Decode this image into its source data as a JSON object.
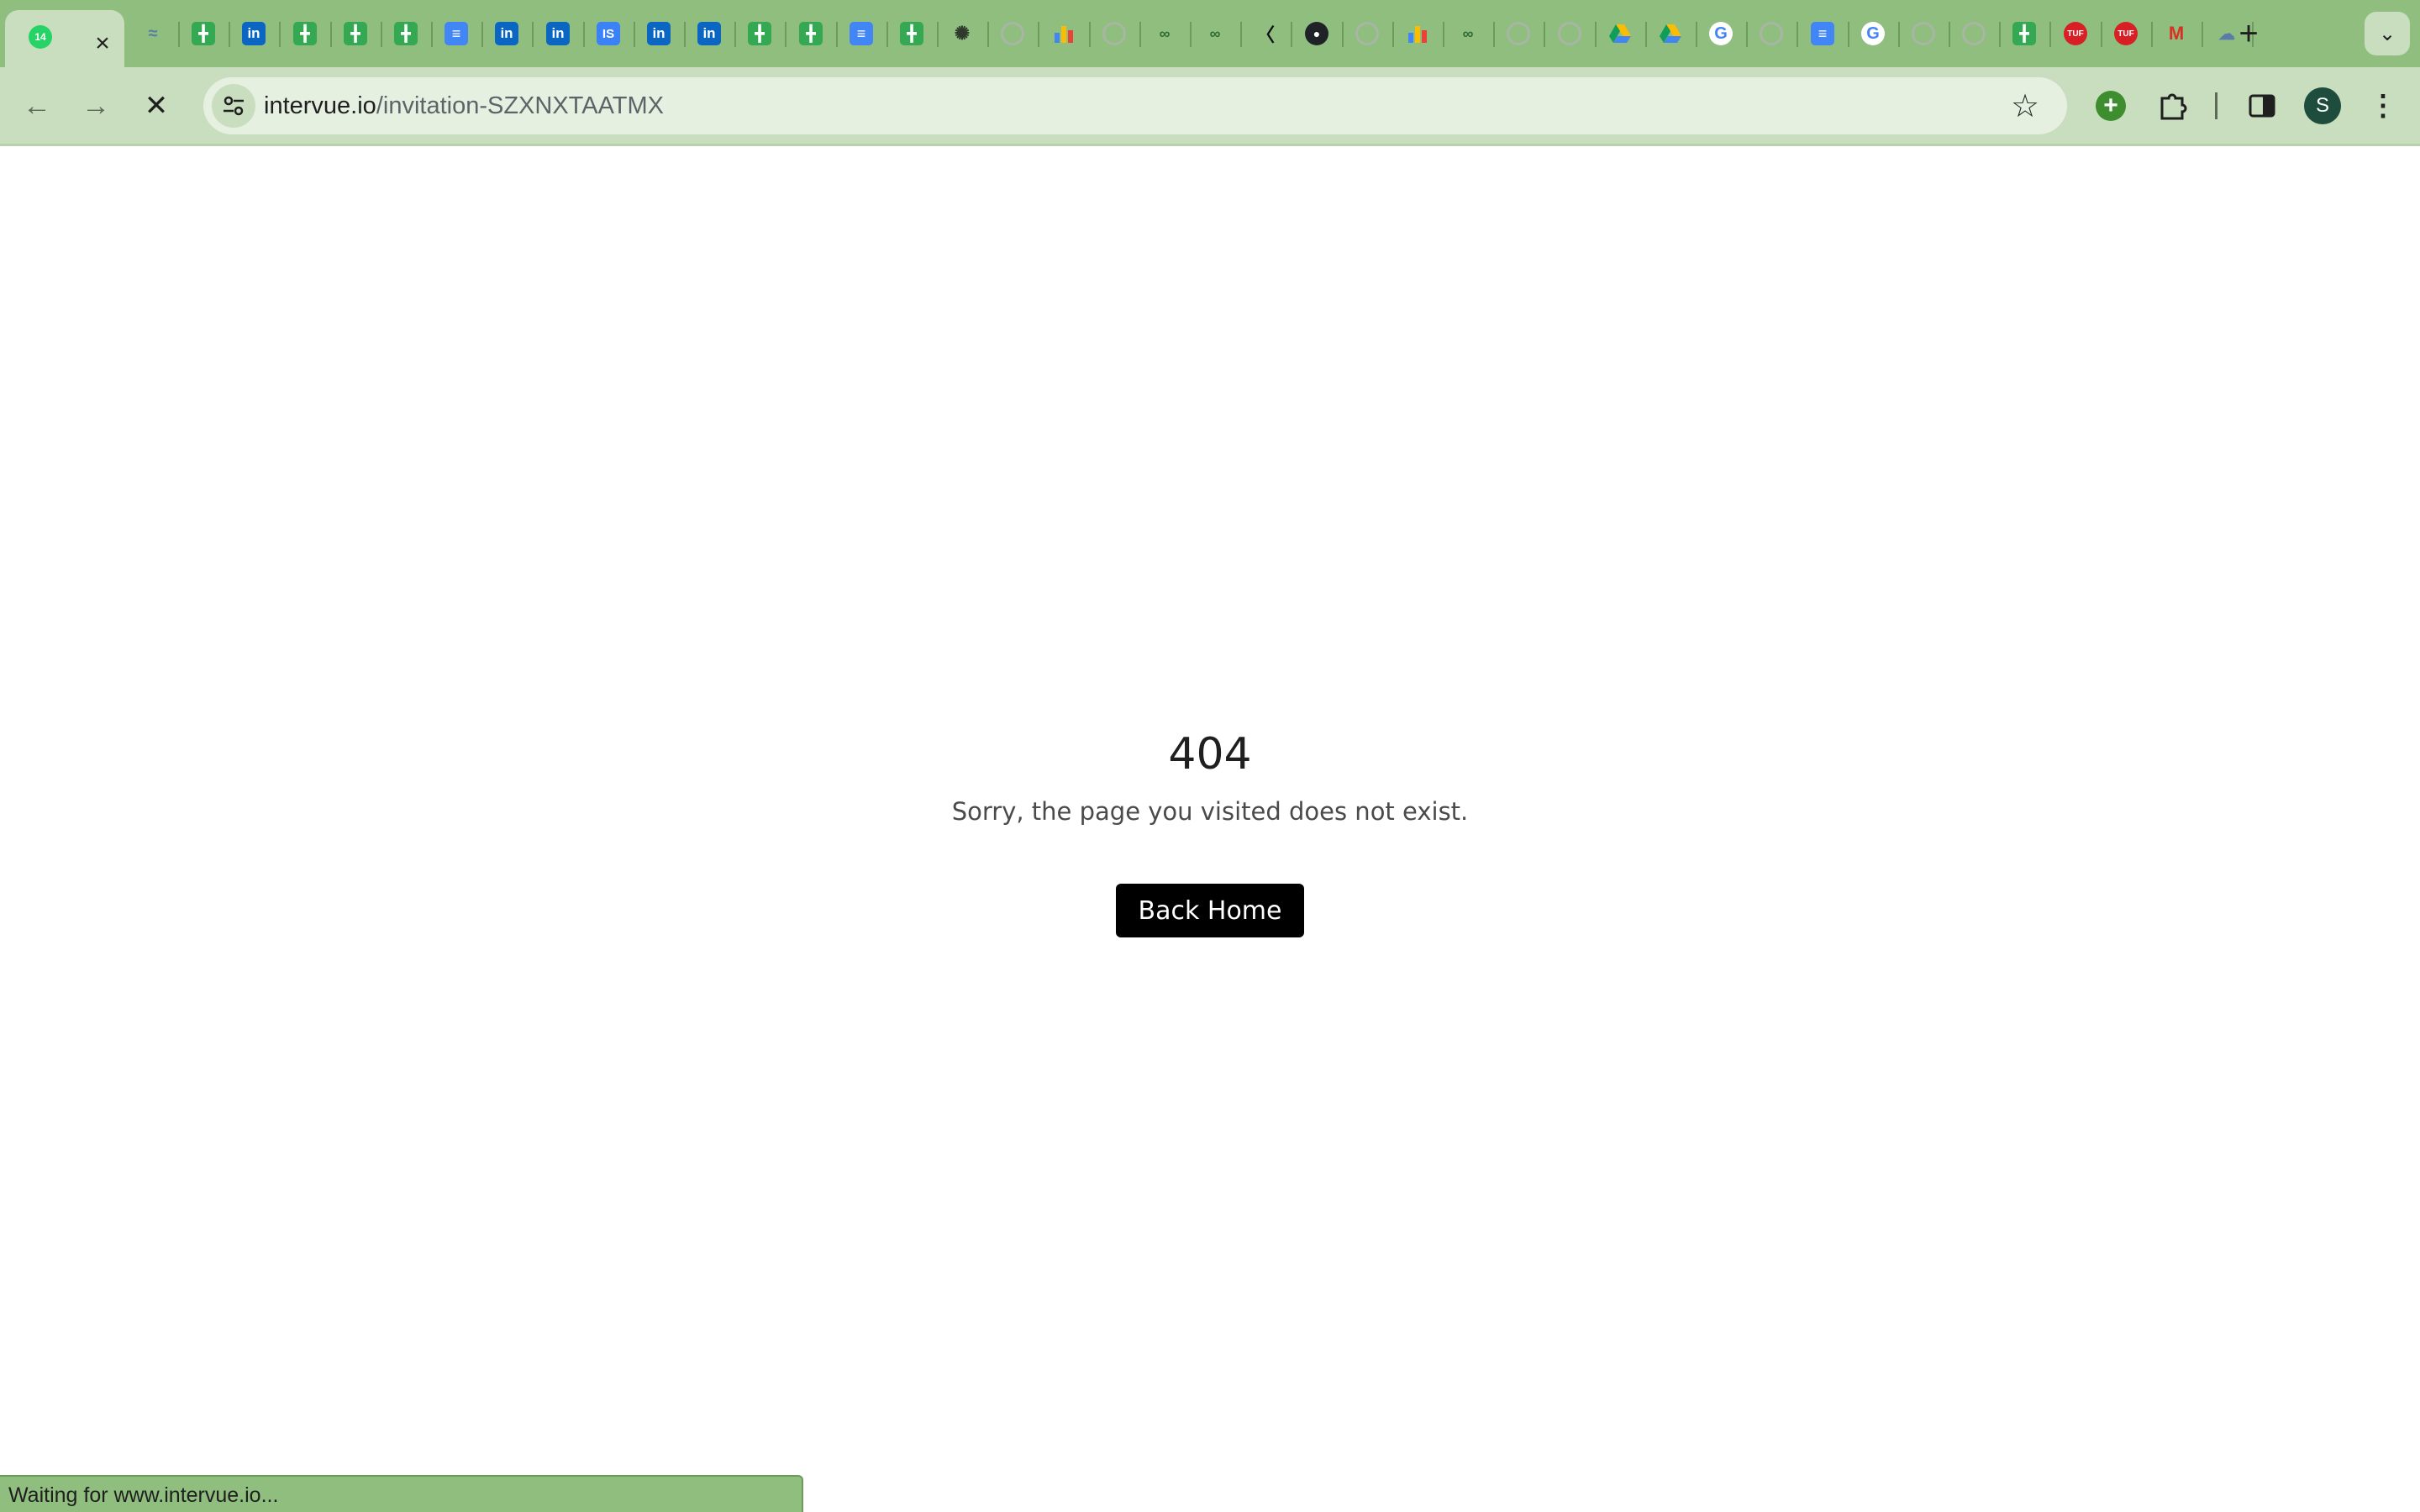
{
  "browser": {
    "active_tab": {
      "badge": "14",
      "close_icon": "×"
    },
    "tabs": [
      {
        "icon": "whatsapp-icon"
      },
      {
        "icon": "wave-icon"
      },
      {
        "icon": "sheets-icon"
      },
      {
        "icon": "linkedin-icon",
        "text": "in"
      },
      {
        "icon": "sheets-icon"
      },
      {
        "icon": "sheets-icon"
      },
      {
        "icon": "sheets-icon"
      },
      {
        "icon": "docs-icon"
      },
      {
        "icon": "linkedin-icon",
        "text": "in"
      },
      {
        "icon": "linkedin-icon",
        "text": "in"
      },
      {
        "icon": "is-icon",
        "text": "IS"
      },
      {
        "icon": "linkedin-icon",
        "text": "in"
      },
      {
        "icon": "linkedin-icon",
        "text": "in"
      },
      {
        "icon": "sheets-icon"
      },
      {
        "icon": "sheets-icon"
      },
      {
        "icon": "docs-icon"
      },
      {
        "icon": "sheets-icon"
      },
      {
        "icon": "openai-icon"
      },
      {
        "icon": "globe-icon"
      },
      {
        "icon": "chart-icon"
      },
      {
        "icon": "globe-icon"
      },
      {
        "icon": "gfg-icon"
      },
      {
        "icon": "gfg-icon"
      },
      {
        "icon": "pen-icon"
      },
      {
        "icon": "github-icon"
      },
      {
        "icon": "globe-icon"
      },
      {
        "icon": "chart-icon"
      },
      {
        "icon": "gfg-icon"
      },
      {
        "icon": "seal-icon"
      },
      {
        "icon": "globe-icon"
      },
      {
        "icon": "drive-icon"
      },
      {
        "icon": "drive-icon"
      },
      {
        "icon": "google-icon"
      },
      {
        "icon": "globe-icon"
      },
      {
        "icon": "docs-icon"
      },
      {
        "icon": "google-icon"
      },
      {
        "icon": "globe-icon"
      },
      {
        "icon": "globe-icon"
      },
      {
        "icon": "sheets-icon"
      },
      {
        "icon": "tuf-icon",
        "text": "TUF"
      },
      {
        "icon": "tuf-icon",
        "text": "TUF"
      },
      {
        "icon": "gmail-icon",
        "text": "M"
      },
      {
        "icon": "cloud-icon"
      }
    ],
    "new_tab_label": "+",
    "tab_search_icon": "chevron-down-icon",
    "url_host": "intervue.io",
    "url_path": "/invitation-SZXNXTAATMX",
    "profile_initial": "S",
    "colors": {
      "frame": "#8fbe7f",
      "toolbar": "#c9ddbf",
      "omnibox": "#e6f0e1"
    }
  },
  "page": {
    "error_code": "404",
    "error_message": "Sorry, the page you visited does not exist.",
    "back_button_label": "Back Home"
  },
  "status": {
    "text": "Waiting for www.intervue.io..."
  }
}
